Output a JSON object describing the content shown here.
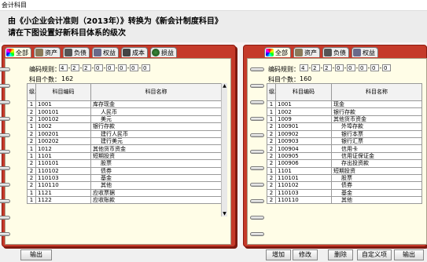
{
  "window": {
    "title": "会计科目"
  },
  "header": {
    "line1": "由《小企业会计准则（2013年）》转换为《新会计制度科目》",
    "line2": "请在下图设置好新科目体系的级次"
  },
  "left": {
    "tabs": [
      "全部",
      "资产",
      "负债",
      "权益",
      "成本",
      "损益"
    ],
    "code_rule_label": "编码规则：",
    "code_rule": [
      "4",
      "2",
      "2",
      "0",
      "0",
      "0",
      "0",
      "0"
    ],
    "count_label": "科目个数：",
    "count": "162",
    "columns": {
      "level": "级次",
      "code": "科目编码",
      "name": "科目名称"
    },
    "rows": [
      [
        "1",
        "1001",
        "库存现金"
      ],
      [
        "2",
        "100101",
        "人民币"
      ],
      [
        "2",
        "100102",
        "美元"
      ],
      [
        "1",
        "1002",
        "银行存款"
      ],
      [
        "2",
        "100201",
        "建行人民币"
      ],
      [
        "2",
        "100202",
        "建行美元"
      ],
      [
        "1",
        "1012",
        "其他货币资金"
      ],
      [
        "1",
        "1101",
        "短期投资"
      ],
      [
        "2",
        "110101",
        "股票"
      ],
      [
        "2",
        "110102",
        "债券"
      ],
      [
        "2",
        "110103",
        "基金"
      ],
      [
        "2",
        "110110",
        "其他"
      ],
      [
        "1",
        "1121",
        "应收票据"
      ],
      [
        "1",
        "1122",
        "应收账款"
      ]
    ]
  },
  "right": {
    "tabs": [
      "全部",
      "资产",
      "负债",
      "权益"
    ],
    "code_rule_label": "编码规则：",
    "code_rule": [
      "4",
      "2",
      "2",
      "0",
      "0",
      "0",
      "0",
      "0"
    ],
    "count_label": "科目个数：",
    "count": "160",
    "columns": {
      "level": "级次",
      "code": "科目编码",
      "name": "科目名称"
    },
    "rows": [
      [
        "1",
        "1001",
        "现金"
      ],
      [
        "1",
        "1002",
        "银行存款"
      ],
      [
        "1",
        "1009",
        "其他货币资金"
      ],
      [
        "2",
        "100901",
        "外埠存款"
      ],
      [
        "2",
        "100902",
        "银行本票"
      ],
      [
        "2",
        "100903",
        "银行汇票"
      ],
      [
        "2",
        "100904",
        "信用卡"
      ],
      [
        "2",
        "100905",
        "信用证保证金"
      ],
      [
        "2",
        "100906",
        "存出投资款"
      ],
      [
        "1",
        "1101",
        "短期投资"
      ],
      [
        "2",
        "110101",
        "股票"
      ],
      [
        "2",
        "110102",
        "债券"
      ],
      [
        "2",
        "110103",
        "基金"
      ],
      [
        "2",
        "110110",
        "其他"
      ]
    ]
  },
  "buttons": {
    "export_left": "输出",
    "add": "增加",
    "modify": "修改",
    "delete": "删除",
    "custom": "自定义项",
    "export_right": "输出"
  },
  "colors": {
    "book": "#c53a2a",
    "page": "#fffde7"
  }
}
